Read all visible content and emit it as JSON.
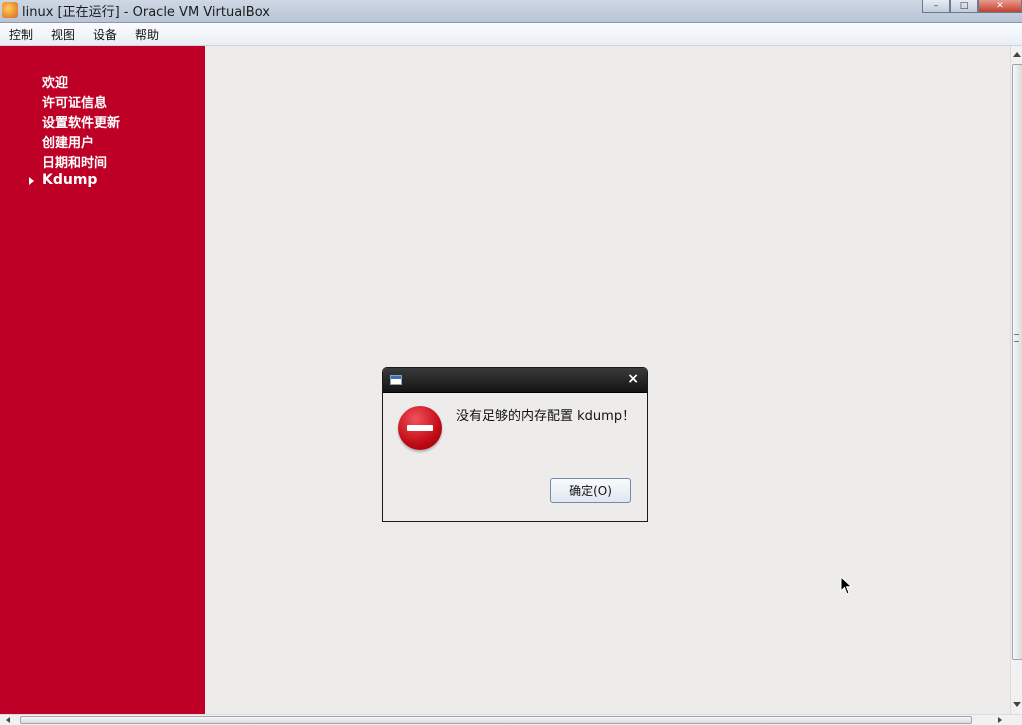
{
  "window": {
    "title": "linux [正在运行] - Oracle VM VirtualBox",
    "buttons": {
      "minimize": "–",
      "maximize": "□",
      "close": "✕"
    }
  },
  "menubar": {
    "items": [
      "控制",
      "视图",
      "设备",
      "帮助"
    ]
  },
  "sidebar": {
    "background": "#be0027",
    "items": [
      {
        "label": "欢迎"
      },
      {
        "label": "许可证信息"
      },
      {
        "label": "设置软件更新"
      },
      {
        "label": "创建用户"
      },
      {
        "label": "日期和时间"
      },
      {
        "label": "Kdump",
        "active": true
      }
    ]
  },
  "dialog": {
    "icon": "error-icon",
    "message": "没有足够的内存配置 kdump！",
    "close_glyph": "×",
    "ok_label": "确定(O)"
  }
}
